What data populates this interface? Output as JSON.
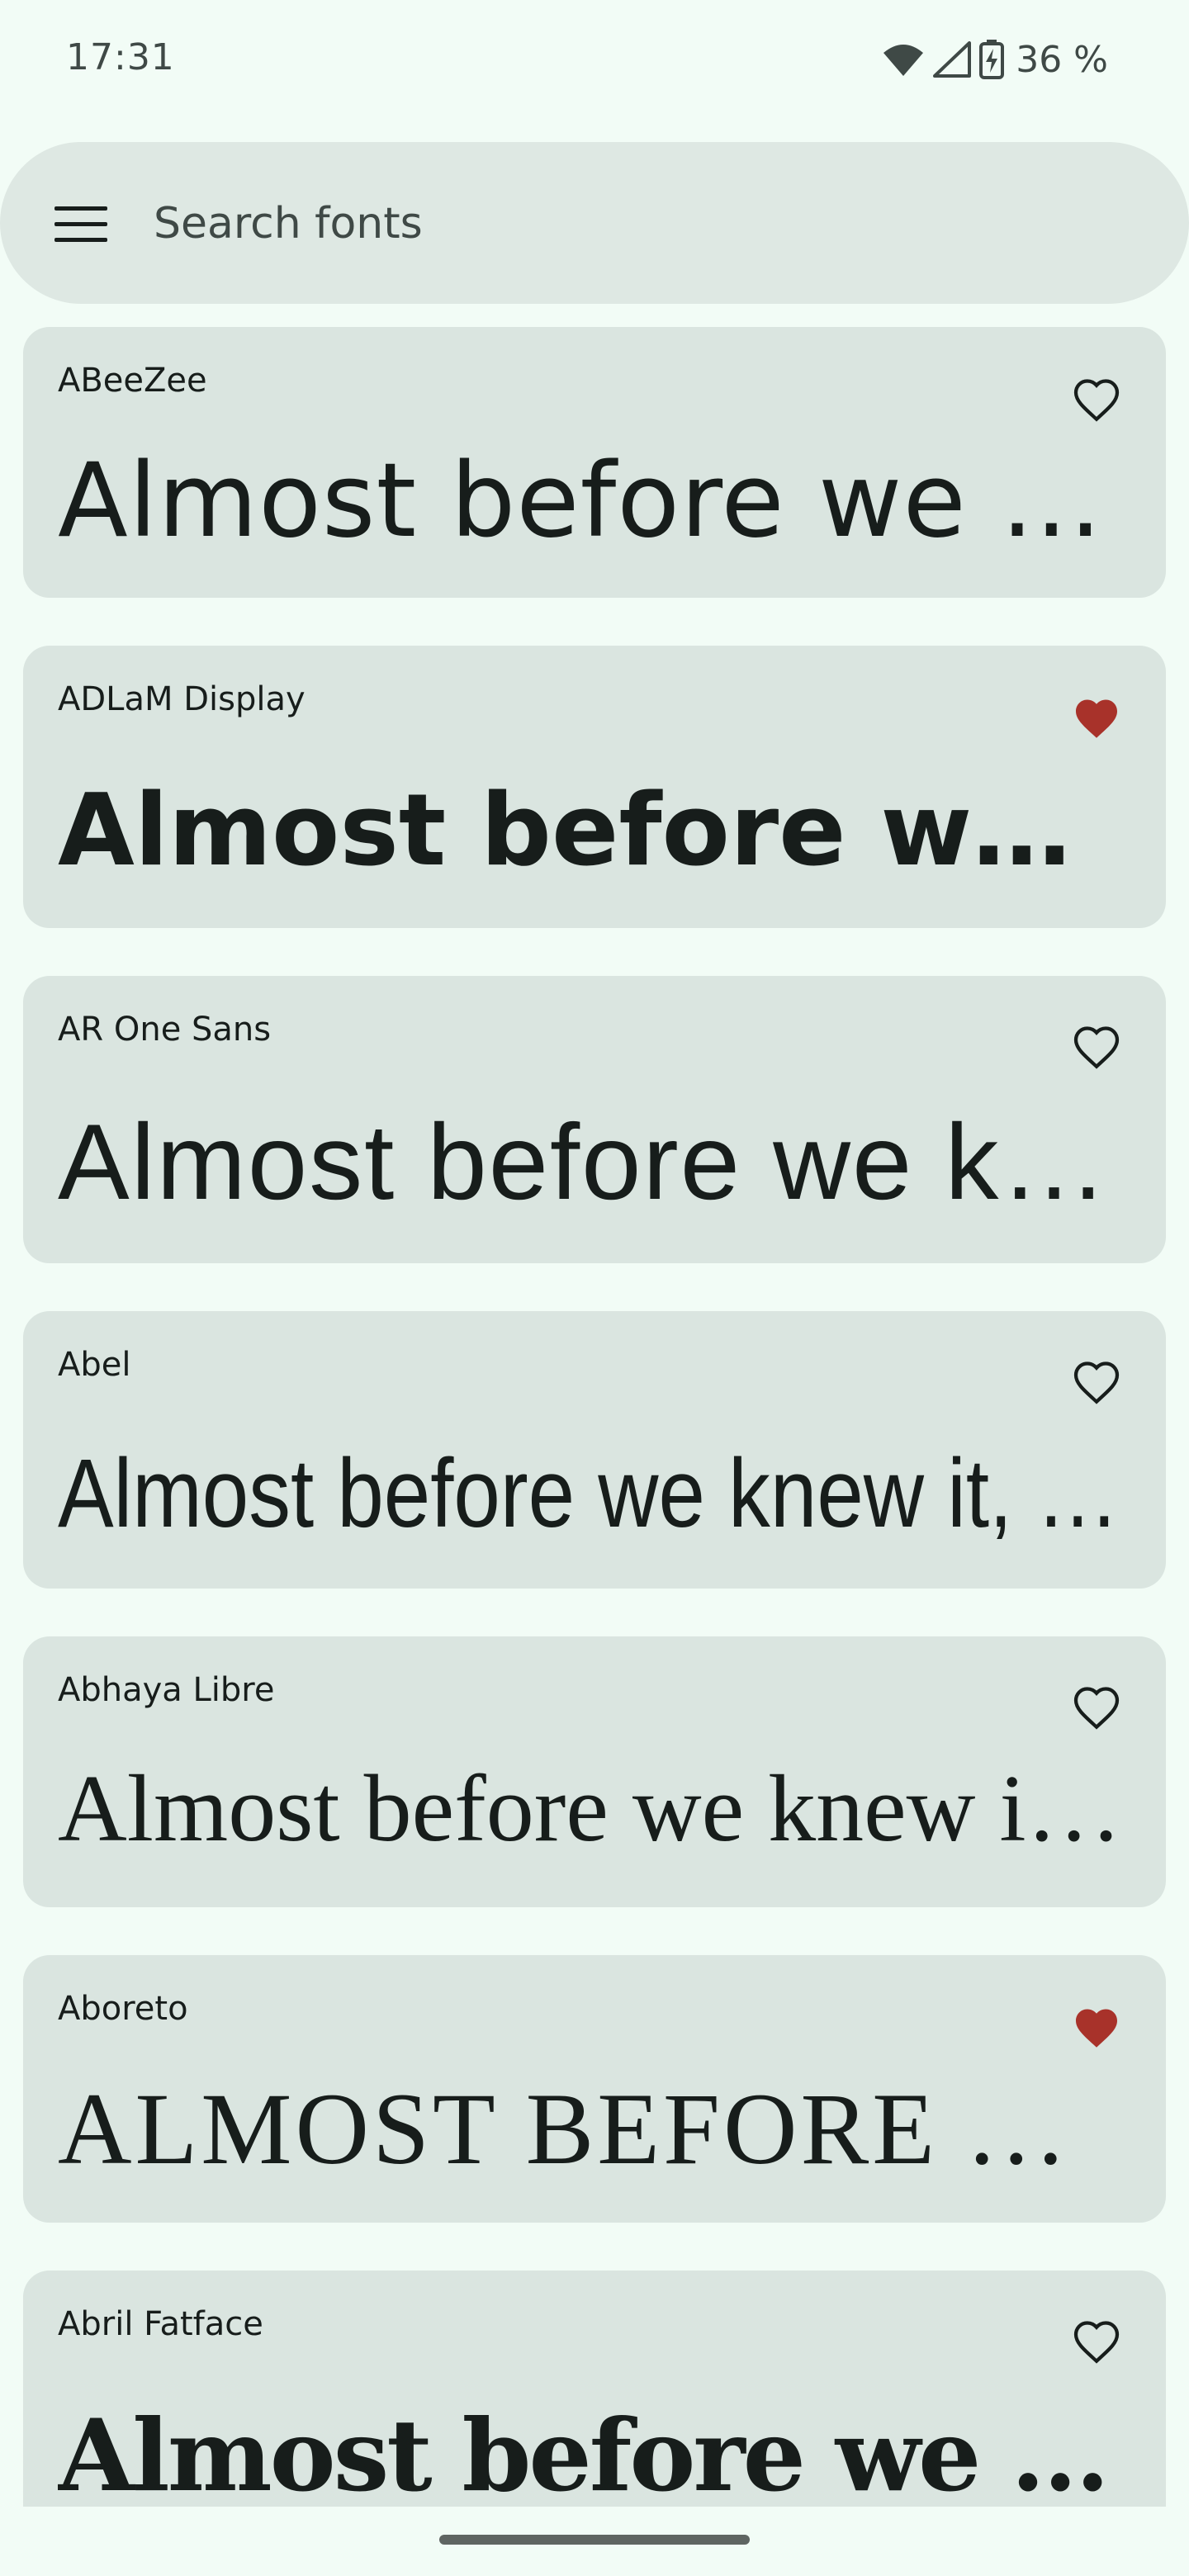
{
  "status_bar": {
    "time": "17:31",
    "battery": "36 %",
    "icons": [
      "wifi-icon",
      "cell-signal-icon",
      "battery-charging-icon"
    ]
  },
  "search": {
    "placeholder": "Search fonts",
    "menu_icon": "hamburger-menu-icon"
  },
  "fonts": [
    {
      "name": "ABeeZee",
      "sample": "Almost before we knew it, we had left the ground.",
      "favorite": false
    },
    {
      "name": "ADLaM Display",
      "sample": "Almost before we knew it, we had left the ground.",
      "favorite": true
    },
    {
      "name": "AR One Sans",
      "sample": "Almost before we knew it, we had left the ground.",
      "favorite": false
    },
    {
      "name": "Abel",
      "sample": "Almost before we knew it, we had left the ground.",
      "favorite": false
    },
    {
      "name": "Abhaya Libre",
      "sample": "Almost before we knew it, we had left the ground.",
      "favorite": false
    },
    {
      "name": "Aboreto",
      "sample": "ALMOST BEFORE WE KNEW IT, WE HAD LEFT THE GROUND.",
      "favorite": true
    },
    {
      "name": "Abril Fatface",
      "sample": "Almost before we knew it, we had left the ground.",
      "favorite": false
    }
  ],
  "colors": {
    "background": "#F2FCF6",
    "card": "#DAE5E0",
    "search_bar": "#DEE8E3",
    "favorite_active": "#A8322A",
    "icon": "#171D1B"
  }
}
